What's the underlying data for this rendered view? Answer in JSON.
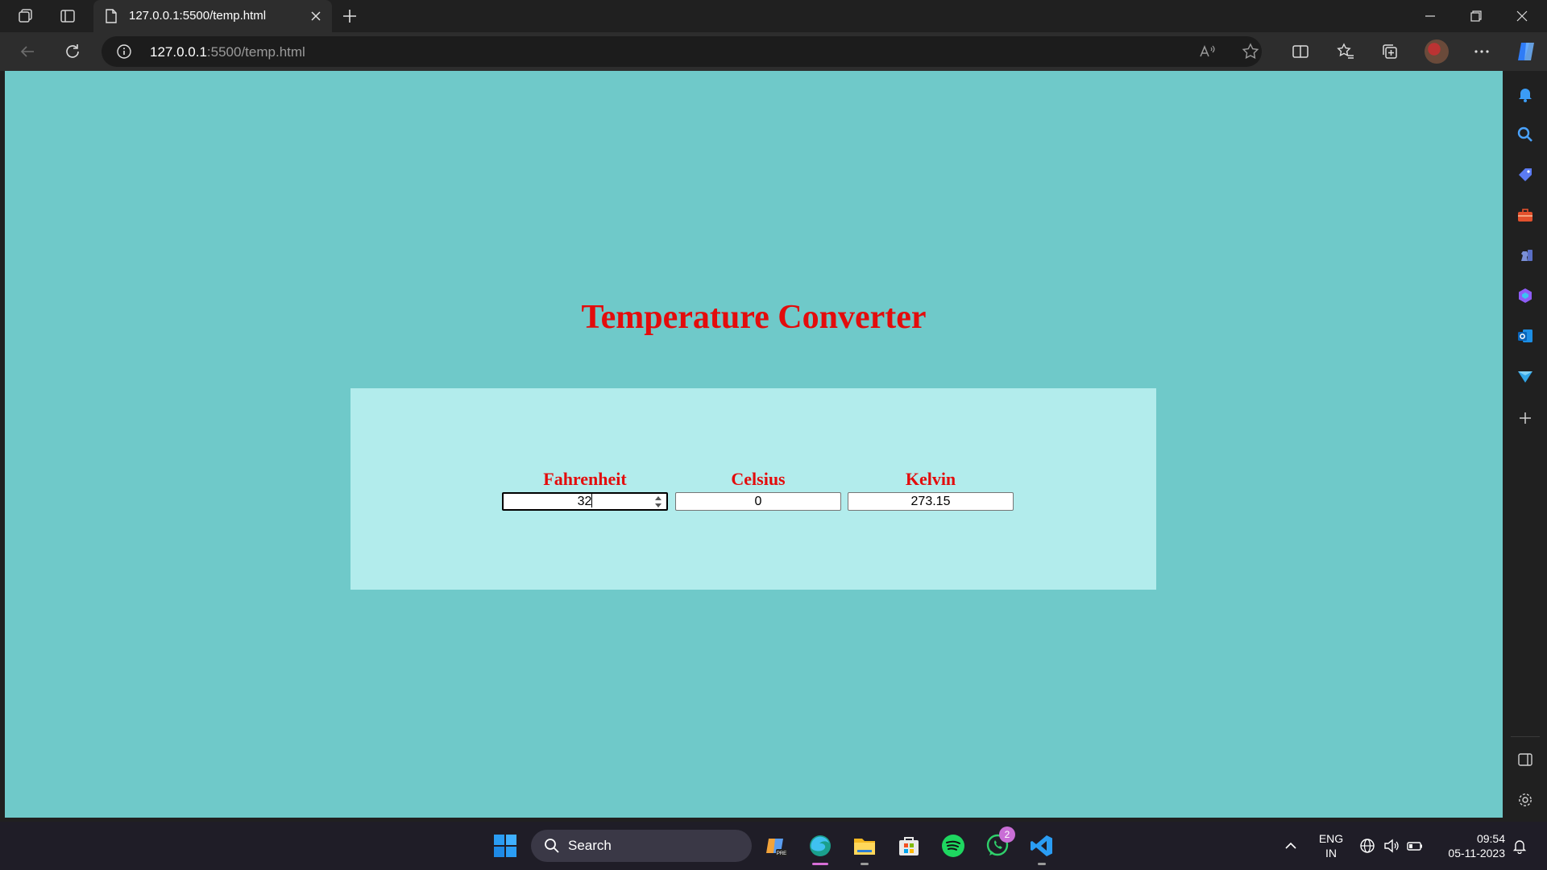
{
  "browser": {
    "tab_title": "127.0.0.1:5500/temp.html",
    "url_host": "127.0.0.1",
    "url_path": ":5500/temp.html"
  },
  "page": {
    "title": "Temperature Converter",
    "fields": [
      {
        "label": "Fahrenheit",
        "value": "32"
      },
      {
        "label": "Celsius",
        "value": "0"
      },
      {
        "label": "Kelvin",
        "value": "273.15"
      }
    ]
  },
  "taskbar": {
    "search_label": "Search",
    "whatsapp_badge": "2",
    "language_line1": "ENG",
    "language_line2": "IN",
    "time": "09:54",
    "date": "05-11-2023"
  }
}
